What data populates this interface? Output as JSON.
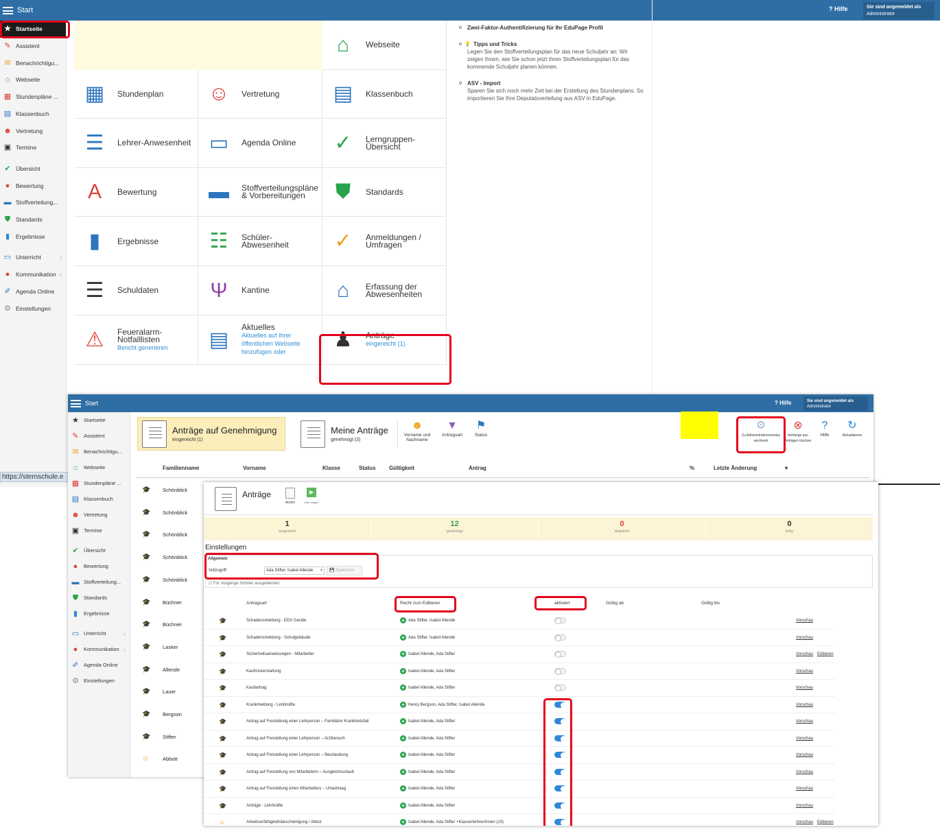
{
  "screen1": {
    "topbar": {
      "title": "Start",
      "help": "Hilfe",
      "user_line1": "Sie sind angemeldet als",
      "user_line2": "Administrator"
    },
    "sidebar": [
      {
        "label": "Startseite",
        "icon": "star-icon",
        "color": "#ffffff",
        "glyph": "★",
        "active": true
      },
      {
        "label": "Assistent",
        "icon": "wand-icon",
        "color": "#e0403a",
        "glyph": "✎"
      },
      {
        "label": "Benachrichtigu...",
        "icon": "envelope-icon",
        "color": "#f0a020",
        "glyph": "✉"
      },
      {
        "label": "Webseite",
        "icon": "house-icon",
        "color": "#2aa44c",
        "glyph": "⌂"
      },
      {
        "label": "Stundenpläne ...",
        "icon": "grid-icon",
        "color": "#e0403a",
        "glyph": "▦"
      },
      {
        "label": "Klassenbuch",
        "icon": "book-icon",
        "color": "#2e75c0",
        "glyph": "▤"
      },
      {
        "label": "Vertretung",
        "icon": "person-icon",
        "color": "#e0403a",
        "glyph": "☻"
      },
      {
        "label": "Termine",
        "icon": "calendar-icon",
        "color": "#333333",
        "glyph": "▣"
      },
      {
        "label": "Übersicht",
        "icon": "check-circle-icon",
        "color": "#2aa44c",
        "glyph": "✔"
      },
      {
        "label": "Bewertung",
        "icon": "grade-icon",
        "color": "#e0403a",
        "glyph": "●"
      },
      {
        "label": "Stoffverteilung...",
        "icon": "briefcase-icon",
        "color": "#2e75c0",
        "glyph": "▬"
      },
      {
        "label": "Standards",
        "icon": "shield-icon",
        "color": "#2aa44c",
        "glyph": "⛊"
      },
      {
        "label": "Ergebnisse",
        "icon": "bar-chart-icon",
        "color": "#2e88d9",
        "glyph": "▮"
      },
      {
        "label": "Unterricht",
        "icon": "book-open-icon",
        "color": "#2e75c0",
        "glyph": "▭",
        "arrow": true
      },
      {
        "label": "Kommunikation",
        "icon": "chat-icon",
        "color": "#e0403a",
        "glyph": "●",
        "arrow": true
      },
      {
        "label": "Agenda Online",
        "icon": "pen-icon",
        "color": "#2e75c0",
        "glyph": "✐"
      },
      {
        "label": "Einstellungen",
        "icon": "gear-icon",
        "color": "#888888",
        "glyph": "⚙"
      }
    ],
    "tiles": [
      {
        "title": "Webseite",
        "icon": "house-icon",
        "color": "#2aa44c",
        "glyph": "⌂"
      },
      {
        "title": "Stundenplan",
        "icon": "timetable-icon",
        "color": "#2e75c0",
        "glyph": "▦"
      },
      {
        "title": "Vertretung",
        "icon": "substitute-icon",
        "color": "#e0403a",
        "glyph": "☺"
      },
      {
        "title": "Klassenbuch",
        "icon": "classbook-icon",
        "color": "#2e75c0",
        "glyph": "▤"
      },
      {
        "title": "Lehrer-Anwesenheit",
        "icon": "teacher-presence-icon",
        "color": "#2e75c0",
        "glyph": "☰"
      },
      {
        "title": "Agenda Online",
        "icon": "open-book-icon",
        "color": "#2e75c0",
        "glyph": "▭"
      },
      {
        "title": "Lerngruppen-",
        "title2": "Übersicht",
        "icon": "check-circle-icon",
        "color": "#2aa44c",
        "glyph": "✓"
      },
      {
        "title": "Bewertung",
        "icon": "grade-icon",
        "color": "#e0403a",
        "glyph": "A"
      },
      {
        "title": "Stoffverteilungspläne",
        "title2": "& Vorbereitungen",
        "icon": "briefcase-icon",
        "color": "#2e75c0",
        "glyph": "▬"
      },
      {
        "title": "Standards",
        "icon": "shield-check-icon",
        "color": "#2aa44c",
        "glyph": "⛊"
      },
      {
        "title": "Ergebnisse",
        "icon": "bar-chart-icon",
        "color": "#2e75c0",
        "glyph": "▮"
      },
      {
        "title": "Schüler-",
        "title2": "Abwesenheit",
        "icon": "checklist-icon",
        "color": "#2aa44c",
        "glyph": "☷"
      },
      {
        "title": "Anmeldungen /",
        "title2": "Umfragen",
        "icon": "clipboard-icon",
        "color": "#f0a020",
        "glyph": "✓"
      },
      {
        "title": "Schuldaten",
        "icon": "database-icon",
        "color": "#333333",
        "glyph": "☰"
      },
      {
        "title": "Kantine",
        "icon": "cutlery-icon",
        "color": "#8a3fa8",
        "glyph": "Ψ"
      },
      {
        "title": "Erfassung der",
        "title2": "Abwesenheiten",
        "icon": "house-person-icon",
        "color": "#2e75c0",
        "glyph": "⌂"
      },
      {
        "title": "Feueralarm-",
        "title2": "Notfalllisten",
        "sub": "Bericht generieren",
        "icon": "alarm-icon",
        "color": "#e0403a",
        "glyph": "⚠"
      },
      {
        "title": "Aktuelles",
        "sub": "Aktuelles auf Ihrer",
        "sub2": "öffentlichen Webseite",
        "sub3": "hinzufügen oder",
        "icon": "news-icon",
        "color": "#2e75c0",
        "glyph": "▤"
      },
      {
        "title": "Anträge",
        "sub": "eingereicht (1)",
        "icon": "stamp-icon",
        "color": "#333333",
        "glyph": "♟"
      }
    ],
    "news": [
      {
        "title": "Zwei-Faktor-Authentifizierung für Ihr EduPage Profil",
        "text": ""
      },
      {
        "title": "Tipps und Tricks",
        "text": "Legen Sie den Stoffverteilungsplan für das neue Schuljahr an: Wir zeigen Ihnen, wie Sie schon jetzt Ihren Stoffverteilungsplan für das kommende Schuljahr planen können.",
        "icon": "bulb-icon"
      },
      {
        "title": "ASV - Import",
        "text": "Sparen Sie sich noch mehr Zeit bei der Erstellung des Stundenplans. So importieren Sie Ihre Deputatsverteilung aus ASV in EduPage."
      }
    ],
    "url": "https://sternschule.e"
  },
  "screen2": {
    "topbar": {
      "title": "Start",
      "help": "Hilfe",
      "user_line1": "Sie sind angemeldet als",
      "user_line2": "Administrator"
    },
    "sidebar": [
      {
        "label": "Startseite",
        "glyph": "★",
        "color": "#333333",
        "icon": "star-icon"
      },
      {
        "label": "Assistent",
        "glyph": "✎",
        "color": "#e0403a",
        "icon": "wand-icon"
      },
      {
        "label": "Benachrichtigu...",
        "glyph": "✉",
        "color": "#f0a020",
        "icon": "envelope-icon"
      },
      {
        "label": "Webseite",
        "glyph": "⌂",
        "color": "#2aa44c",
        "icon": "house-icon"
      },
      {
        "label": "Stundenpläne ...",
        "glyph": "▦",
        "color": "#e0403a",
        "icon": "grid-icon"
      },
      {
        "label": "Klassenbuch",
        "glyph": "▤",
        "color": "#2e75c0",
        "icon": "book-icon"
      },
      {
        "label": "Vertretung",
        "glyph": "☻",
        "color": "#e0403a",
        "icon": "person-icon"
      },
      {
        "label": "Termine",
        "glyph": "▣",
        "color": "#333333",
        "icon": "calendar-icon"
      },
      {
        "label": "Übersicht",
        "glyph": "✔",
        "color": "#2aa44c",
        "icon": "check-circle-icon"
      },
      {
        "label": "Bewertung",
        "glyph": "●",
        "color": "#e0403a",
        "icon": "grade-icon"
      },
      {
        "label": "Stoffverteilung...",
        "glyph": "▬",
        "color": "#2e75c0",
        "icon": "briefcase-icon"
      },
      {
        "label": "Standards",
        "glyph": "⛊",
        "color": "#2aa44c",
        "icon": "shield-icon"
      },
      {
        "label": "Ergebnisse",
        "glyph": "▮",
        "color": "#2e88d9",
        "icon": "bar-chart-icon"
      },
      {
        "label": "Unterricht",
        "glyph": "▭",
        "color": "#2e75c0",
        "icon": "book-open-icon",
        "arrow": true
      },
      {
        "label": "Kommunikation",
        "glyph": "●",
        "color": "#e0403a",
        "icon": "chat-icon",
        "arrow": true
      },
      {
        "label": "Agenda Online",
        "glyph": "✐",
        "color": "#2e75c0",
        "icon": "pen-icon"
      },
      {
        "label": "Einstellungen",
        "glyph": "⚙",
        "color": "#888888",
        "icon": "gear-icon"
      }
    ],
    "tab_active": {
      "title": "Anträge auf Genehmigung",
      "sub": "eingereicht (1)"
    },
    "tab_mine": {
      "title": "Meine Anträge",
      "sub": "genehmigt (3)"
    },
    "filters": [
      {
        "label": "Vorname und Nachname",
        "icon": "person-filter-icon"
      },
      {
        "label": "Antragsart",
        "icon": "funnel-icon"
      },
      {
        "label": "Status",
        "icon": "status-icon"
      }
    ],
    "actions": [
      {
        "label": "Zu Administrationsmodus wechseln",
        "icon": "gears-icon"
      },
      {
        "label": "Anhänge aus Anträgen löschen",
        "icon": "delete-icon"
      },
      {
        "label": "Hilfe",
        "icon": "help-icon"
      },
      {
        "label": "Aktualisieren",
        "icon": "refresh-icon"
      }
    ],
    "columns": [
      "Familienname",
      "Vorname",
      "Klasse",
      "Status",
      "Gültigkeit",
      "Antrag",
      "%",
      "Letzte Änderung"
    ],
    "rows": [
      "Schönblick",
      "Schönblick",
      "Schönblick",
      "Schönblick",
      "Schönblick",
      "Büchner",
      "Büchner",
      "Lasker",
      "Allende",
      "Lauer",
      "Bergson",
      "Stifter",
      "Abbott"
    ]
  },
  "screen3": {
    "title": "Anträge",
    "toolbar": [
      "Archiv",
      "Liste zeigen"
    ],
    "stats": [
      {
        "value": "1",
        "label": "eingereicht",
        "color": "#333333"
      },
      {
        "value": "12",
        "label": "genehmigt",
        "color": "#2aa44c"
      },
      {
        "value": "0",
        "label": "abgelehnt",
        "color": "#e0403a"
      },
      {
        "value": "0",
        "label": "fertig",
        "color": "#333333"
      }
    ],
    "settings_title": "Einstellungen",
    "general": {
      "title": "Allgemein",
      "access_label": "Vollzugriff",
      "access_value": "Ada Stifter, Isabel Allende",
      "save": "Speichern",
      "checkbox": "Für Vorgänge Schüler ausgeblendet"
    },
    "columns": [
      "Antragsart",
      "Recht zum Editieren",
      "aktiviert",
      "Gültig ab",
      "Gültig bis"
    ],
    "rows": [
      {
        "type": "Schadensmeldung - EDV Geräte",
        "who": "Ada Stifter, Isabel Allende",
        "on": false,
        "preview": "Vorschau",
        "edit": ""
      },
      {
        "type": "Schadensmeldung - Schulgebäude",
        "who": "Ada Stifter, Isabel Allende",
        "on": false,
        "preview": "Vorschau",
        "edit": ""
      },
      {
        "type": "Sicherheitsanweisungen - Mitarbeiter",
        "who": "Isabel Allende, Ada Stifter",
        "on": false,
        "preview": "Vorschau",
        "edit": "Editieren"
      },
      {
        "type": "Kaufrückerstattung",
        "who": "Isabel Allende, Ada Stifter",
        "on": false,
        "preview": "Vorschau",
        "edit": ""
      },
      {
        "type": "Kaufantrag",
        "who": "Isabel Allende, Ada Stifter",
        "on": false,
        "preview": "Vorschau",
        "edit": ""
      },
      {
        "type": "Krankmeldung - Lehrkräfte",
        "who": "Henry Bergson, Ada Stifter, Isabel Allende",
        "on": true,
        "preview": "Vorschau",
        "edit": ""
      },
      {
        "type": "Antrag auf Freistellung einer Lehrperson – Familiärer Krankheitsfall",
        "who": "Isabel Allende, Ada Stifter",
        "on": true,
        "preview": "Vorschau",
        "edit": ""
      },
      {
        "type": "Antrag auf Freistellung einer Lehrperson – Arztbesuch",
        "who": "Isabel Allende, Ada Stifter",
        "on": true,
        "preview": "Vorschau",
        "edit": ""
      },
      {
        "type": "Antrag auf Freistellung einer Lehrperson – Beurlaubung",
        "who": "Isabel Allende, Ada Stifter",
        "on": true,
        "preview": "Vorschau",
        "edit": ""
      },
      {
        "type": "Antrag auf Freistellung von Mitarbeitern – Ausgleichsurlaub",
        "who": "Isabel Allende, Ada Stifter",
        "on": true,
        "preview": "Vorschau",
        "edit": ""
      },
      {
        "type": "Antrag auf Freistellung eines Mitarbeiters – Urlaubstag",
        "who": "Isabel Allende, Ada Stifter",
        "on": true,
        "preview": "Vorschau",
        "edit": ""
      },
      {
        "type": "Anträge - Lehrkräfte",
        "who": "Isabel Allende, Ada Stifter",
        "on": true,
        "preview": "Vorschau",
        "edit": ""
      },
      {
        "type": "Arbeitsunfähigkeitsbescheinigung / Attest",
        "who": "Isabel Allende, Ada Stifter +Klassenlehrer/innen (10)",
        "on": true,
        "preview": "Vorschau",
        "edit": "Editieren"
      }
    ]
  }
}
